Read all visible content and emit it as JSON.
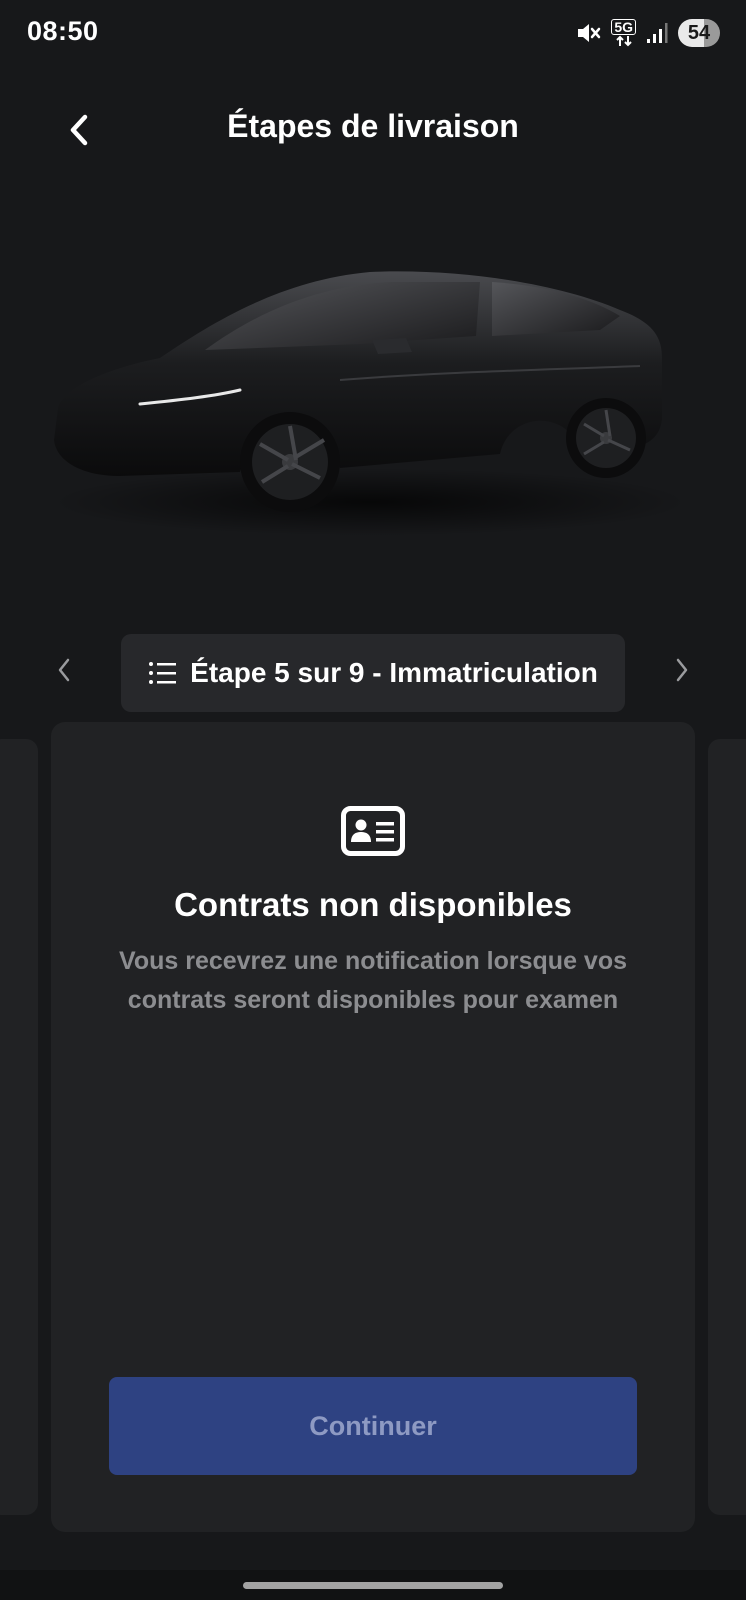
{
  "status_bar": {
    "time": "08:50",
    "network": "5G",
    "battery": "54",
    "icons": [
      "mute-icon",
      "5g-icon",
      "signal-icon",
      "battery-icon"
    ]
  },
  "header": {
    "title": "Étapes de livraison",
    "back_icon": "chevron-left-icon"
  },
  "vehicle": {
    "image": "black-suv-image"
  },
  "step_nav": {
    "label": "Étape 5 sur 9 - Immatriculation",
    "list_icon": "list-icon",
    "prev_icon": "chevron-left-icon",
    "next_icon": "chevron-right-icon"
  },
  "card": {
    "icon": "id-card-icon",
    "title": "Contrats non disponibles",
    "description": "Vous recevrez une notification lorsque vos contrats seront disponibles pour examen",
    "button_label": "Continuer"
  },
  "colors": {
    "background": "#17181a",
    "card": "#212224",
    "pill": "#27282b",
    "button": "#2e4282",
    "button_text": "#8e9ac3",
    "muted_text": "#8c8d90"
  }
}
